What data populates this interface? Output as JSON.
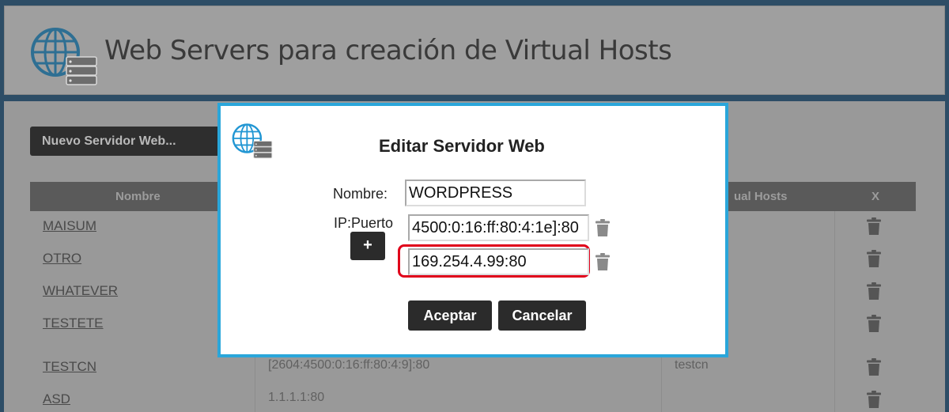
{
  "header": {
    "title": "Web Servers para creación de Virtual Hosts"
  },
  "toolbar": {
    "new_server_label": "Nuevo Servidor Web..."
  },
  "table": {
    "columns": {
      "name": "Nombre",
      "virtual_hosts": "ual Hosts",
      "delete": "X"
    },
    "rows": [
      {
        "name": "MAISUM",
        "ip": "",
        "virtual_hosts": ""
      },
      {
        "name": "OTRO",
        "ip": "",
        "virtual_hosts": ""
      },
      {
        "name": "WHATEVER",
        "ip": "",
        "virtual_hosts": ""
      },
      {
        "name": "TESTETE",
        "ip": "",
        "virtual_hosts": ""
      },
      {
        "name": "TESTCN",
        "ip": "[2604:4500:0:16:ff:80:4:9]:80",
        "virtual_hosts": "testcn"
      },
      {
        "name": "ASD",
        "ip": "1.1.1.1:80",
        "virtual_hosts": ""
      }
    ]
  },
  "modal": {
    "title": "Editar Servidor Web",
    "name_label": "Nombre:",
    "name_value": "WORDPRESS",
    "ip_label": "IP:Puerto",
    "add_label": "+",
    "ip_values": [
      "4500:0:16:ff:80:4:1e]:80",
      "169.254.4.99:80"
    ],
    "accept_label": "Aceptar",
    "cancel_label": "Cancelar"
  },
  "colors": {
    "background": "#2d4d66",
    "modal_border": "#2aa6da",
    "highlight": "#e0001a",
    "button": "#2b2b2b"
  },
  "icons": [
    "globe-server-icon",
    "trash-icon"
  ]
}
